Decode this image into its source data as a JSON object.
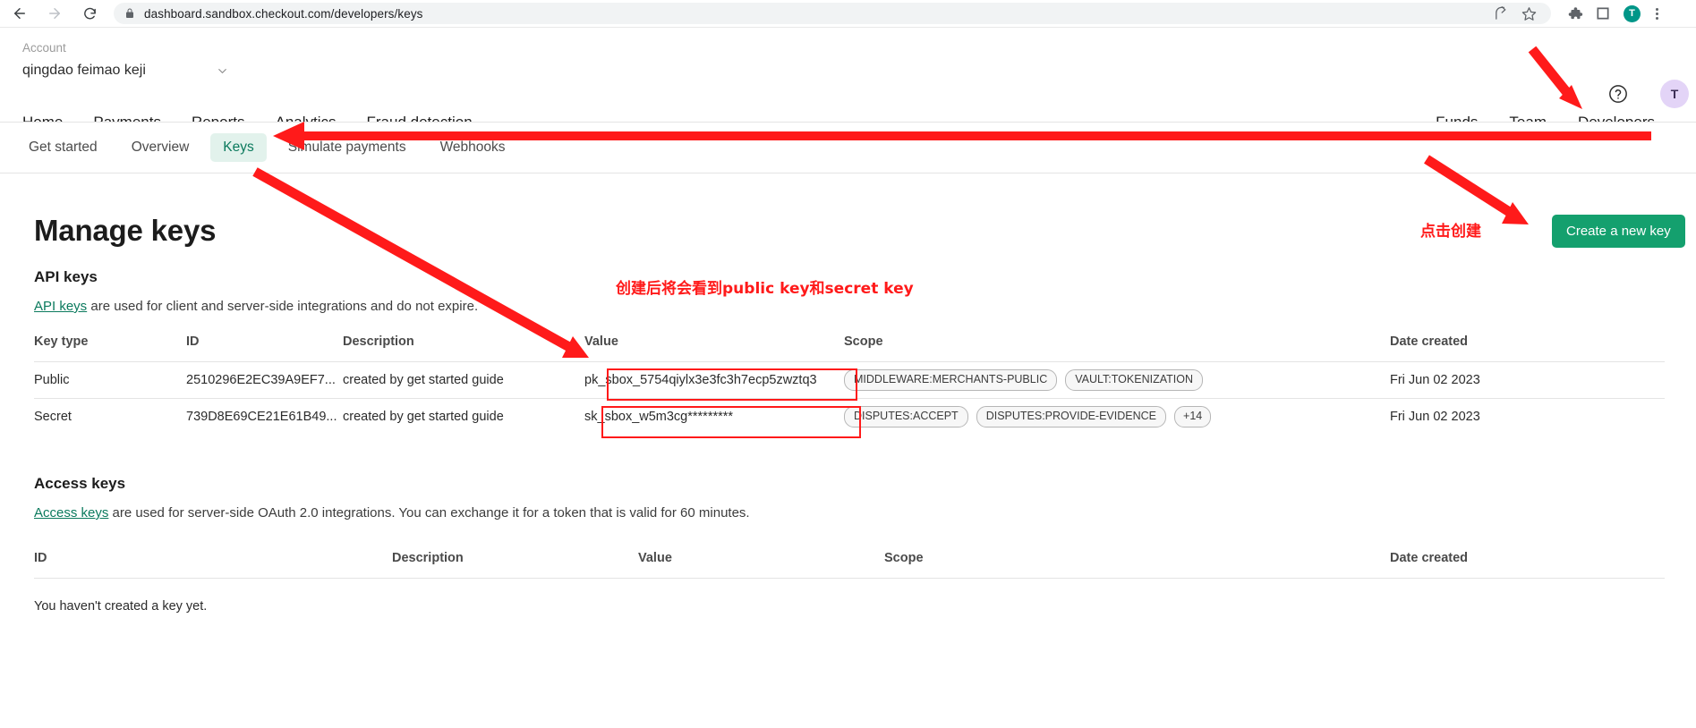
{
  "browser": {
    "url": "dashboard.sandbox.checkout.com/developers/keys",
    "back_icon": "back-arrow-icon",
    "forward_icon": "forward-arrow-icon",
    "reload_icon": "reload-icon",
    "lock_icon": "lock-icon",
    "share_icon": "share-icon",
    "bookmark_icon": "star-icon",
    "extensions_icon": "puzzle-icon",
    "sidepanel_icon": "square-icon",
    "profile_initial": "T",
    "menu_icon": "kebab-menu-icon"
  },
  "header": {
    "account_label": "Account",
    "account_name": "qingdao feimao keji",
    "caret_icon": "chevron-down-icon",
    "help_icon": "help-circle-icon",
    "avatar_initial": "T",
    "main_nav": [
      {
        "label": "Home"
      },
      {
        "label": "Payments"
      },
      {
        "label": "Reports"
      },
      {
        "label": "Analytics"
      },
      {
        "label": "Fraud detection"
      }
    ],
    "right_nav": [
      {
        "label": "Funds",
        "active": false
      },
      {
        "label": "Team",
        "active": false
      },
      {
        "label": "Developers",
        "active": true
      }
    ]
  },
  "subtabs": [
    {
      "label": "Get started",
      "active": false
    },
    {
      "label": "Overview",
      "active": false
    },
    {
      "label": "Keys",
      "active": true
    },
    {
      "label": "Simulate payments",
      "active": false
    },
    {
      "label": "Webhooks",
      "active": false
    }
  ],
  "page": {
    "title": "Manage keys",
    "create_button": "Create a new key",
    "api_section": {
      "title": "API keys",
      "desc_link": "API keys",
      "desc_rest": " are used for client and server-side integrations and do not expire.",
      "columns": [
        "Key type",
        "ID",
        "Description",
        "Value",
        "Scope",
        "Date created"
      ],
      "rows": [
        {
          "key_type": "Public",
          "id": "2510296E2EC39A9EF7...",
          "description": "created by get started guide",
          "value": "pk_sbox_5754qiylx3e3fc3h7ecp5zwztq3",
          "scopes": [
            "MIDDLEWARE:MERCHANTS-PUBLIC",
            "VAULT:TOKENIZATION"
          ],
          "extra_scopes": "",
          "date_created": "Fri Jun 02 2023"
        },
        {
          "key_type": "Secret",
          "id": "739D8E69CE21E61B49...",
          "description": "created by get started guide",
          "value": "sk_sbox_w5m3cg*********",
          "scopes": [
            "DISPUTES:ACCEPT",
            "DISPUTES:PROVIDE-EVIDENCE"
          ],
          "extra_scopes": "+14",
          "date_created": "Fri Jun 02 2023"
        }
      ]
    },
    "access_section": {
      "title": "Access keys",
      "desc_link": "Access keys",
      "desc_rest": " are used for server-side OAuth 2.0 integrations. You can exchange it for a token that is valid for 60 minutes.",
      "columns": [
        "ID",
        "Description",
        "Value",
        "Scope",
        "Date created"
      ],
      "empty_message": "You haven't created a key yet."
    }
  },
  "annotations": {
    "color": "#ff1a1a",
    "note_middle": "创建后将会看到public key和secret key",
    "note_button": "点击创建",
    "arrow_team_name": "arrow-pointing-to-team",
    "arrow_create_name": "arrow-pointing-to-create-button",
    "arrow_keys_tab_name": "arrow-pointing-to-keys-tab",
    "arrow_value_col_name": "arrow-pointing-to-value-column"
  },
  "colors": {
    "brand_green": "#0b7a5d",
    "button_green": "#14a06e",
    "active_tab_bg": "#e2f2ec",
    "annotation_red": "#ff1a1a",
    "avatar_app_bg": "#e3d4f7",
    "avatar_browser_bg": "#009688"
  }
}
